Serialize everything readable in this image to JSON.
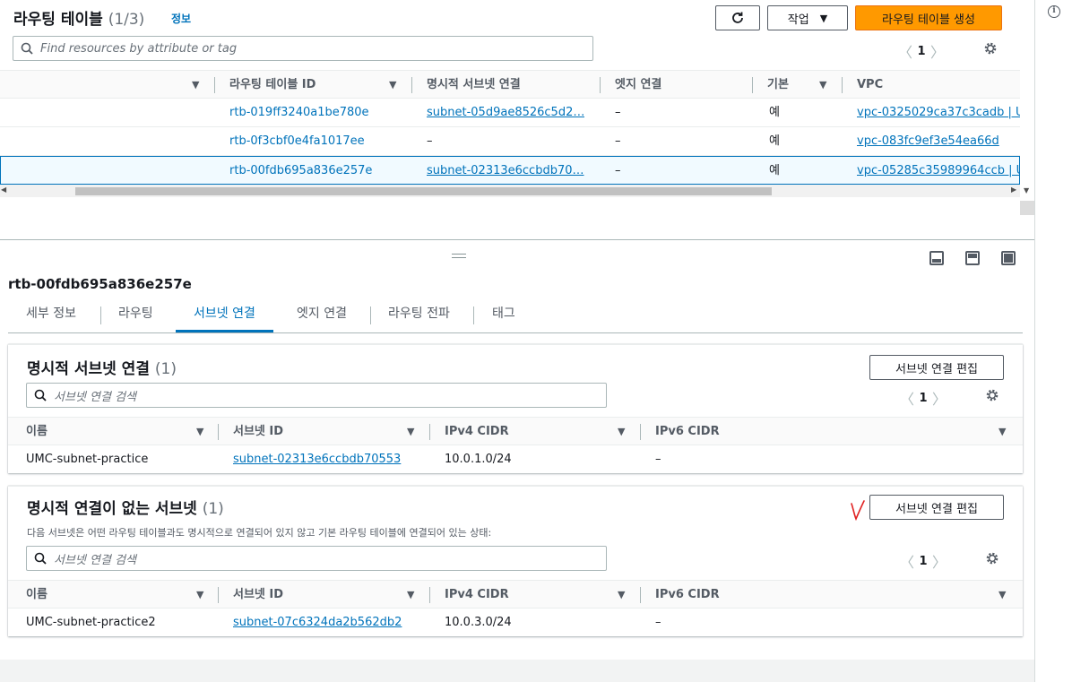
{
  "route_tables": {
    "title": "라우팅 테이블",
    "count": "(1/3)",
    "info_link": "정보",
    "actions_label": "작업",
    "create_label": "라우팅 테이블 생성",
    "search_placeholder": "Find resources by attribute or tag",
    "page": "1",
    "columns": [
      "라우팅 테이블 ID",
      "명시적 서브넷 연결",
      "엣지 연결",
      "기본",
      "VPC"
    ],
    "rows": [
      {
        "id": "rtb-019ff3240a1be780e",
        "subnet": "subnet-05d9ae8526c5d2…",
        "edge": "–",
        "main": "예",
        "vpc": "vpc-0325029ca37c3cadb | U"
      },
      {
        "id": "rtb-0f3cbf0e4fa1017ee",
        "subnet": "–",
        "edge": "–",
        "main": "예",
        "vpc": "vpc-083fc9ef3e54ea66d"
      },
      {
        "id": "rtb-00fdb695a836e257e",
        "subnet": "subnet-02313e6ccbdb70…",
        "edge": "–",
        "main": "예",
        "vpc": "vpc-05285c35989964ccb | U"
      }
    ]
  },
  "detail": {
    "title": "rtb-00fdb695a836e257e",
    "tabs": [
      "세부 정보",
      "라우팅",
      "서브넷 연결",
      "엣지 연결",
      "라우팅 전파",
      "태그"
    ],
    "explicit": {
      "title": "명시적 서브넷 연결",
      "count": "(1)",
      "edit_label": "서브넷 연결 편집",
      "search_placeholder": "서브넷 연결 검색",
      "page": "1",
      "columns": [
        "이름",
        "서브넷 ID",
        "IPv4 CIDR",
        "IPv6 CIDR"
      ],
      "rows": [
        {
          "name": "UMC-subnet-practice",
          "subnet_id": "subnet-02313e6ccbdb70553",
          "ipv4": "10.0.1.0/24",
          "ipv6": "–"
        }
      ]
    },
    "without": {
      "title": "명시적 연결이 없는 서브넷",
      "count": "(1)",
      "description": "다음 서브넷은 어떤 라우팅 테이블과도 명시적으로 연결되어 있지 않고 기본 라우팅 테이블에 연결되어 있는 상태:",
      "edit_label": "서브넷 연결 편집",
      "search_placeholder": "서브넷 연결 검색",
      "page": "1",
      "columns": [
        "이름",
        "서브넷 ID",
        "IPv4 CIDR",
        "IPv6 CIDR"
      ],
      "rows": [
        {
          "name": "UMC-subnet-practice2",
          "subnet_id": "subnet-07c6324da2b562db2",
          "ipv4": "10.0.3.0/24",
          "ipv6": "–"
        }
      ]
    }
  },
  "colors": {
    "accent": "#0073bb",
    "primary_button": "#ff9900",
    "annotation": "#e02020"
  }
}
